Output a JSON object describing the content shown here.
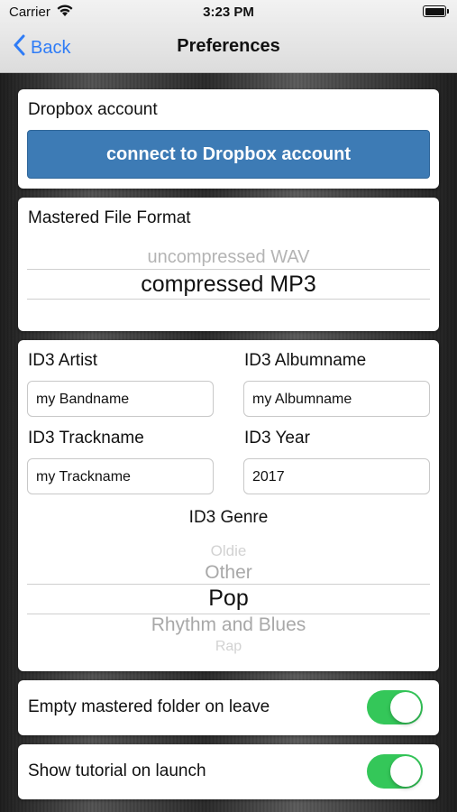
{
  "status_bar": {
    "carrier": "Carrier",
    "time": "3:23 PM"
  },
  "nav": {
    "back_label": "Back",
    "title": "Preferences"
  },
  "dropbox": {
    "label": "Dropbox account",
    "button_label": "connect to Dropbox account"
  },
  "file_format": {
    "label": "Mastered File Format",
    "options": [
      "uncompressed WAV",
      "compressed MP3"
    ],
    "selected": "compressed MP3"
  },
  "id3": {
    "artist": {
      "label": "ID3 Artist",
      "value": "my Bandname"
    },
    "albumname": {
      "label": "ID3 Albumname",
      "value": "my Albumname"
    },
    "trackname": {
      "label": "ID3 Trackname",
      "value": "my Trackname"
    },
    "year": {
      "label": "ID3 Year",
      "value": "2017"
    },
    "genre": {
      "label": "ID3 Genre",
      "options": [
        "Oldie",
        "Other",
        "Pop",
        "Rhythm and Blues",
        "Rap"
      ],
      "selected": "Pop"
    }
  },
  "settings": {
    "empty_folder": {
      "label": "Empty mastered folder on leave",
      "on": true
    },
    "show_tutorial": {
      "label": "Show tutorial on launch",
      "on": true
    }
  },
  "colors": {
    "accent": "#2f7cf6",
    "button": "#3d7bb5",
    "toggle_on": "#34c759"
  }
}
